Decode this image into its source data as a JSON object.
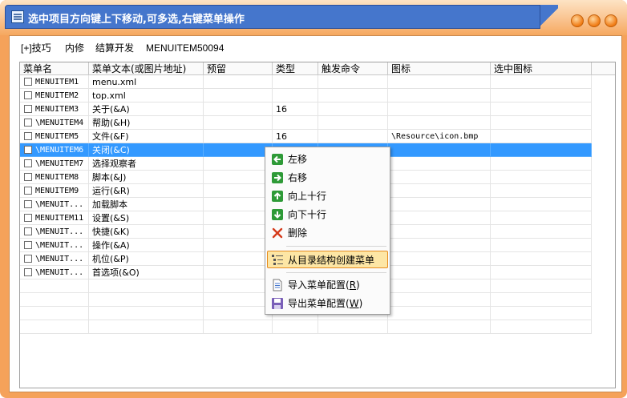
{
  "window": {
    "title": "选中项目方向键上下移动,可多选,右键菜单操作",
    "accent": "#4576cc",
    "frame_color": "#f5a25a"
  },
  "menubar": [
    "[+]技巧",
    "内修",
    "结算开发",
    "MENUITEM50094"
  ],
  "grid": {
    "columns": [
      "菜单名",
      "菜单文本(或图片地址)",
      "预留",
      "类型",
      "触发命令",
      "图标",
      "选中图标"
    ],
    "rows": [
      {
        "name": "MENUITEM1",
        "text": "menu.xml",
        "reserve": "",
        "type": "",
        "cmd": "",
        "icon": "",
        "sel_icon": ""
      },
      {
        "name": "MENUITEM2",
        "text": "top.xml",
        "reserve": "",
        "type": "",
        "cmd": "",
        "icon": "",
        "sel_icon": ""
      },
      {
        "name": "MENUITEM3",
        "text": "关于(&A)",
        "reserve": "",
        "type": "16",
        "cmd": "",
        "icon": "",
        "sel_icon": ""
      },
      {
        "name": "\\MENUITEM4",
        "text": "帮助(&H)",
        "reserve": "",
        "type": "",
        "cmd": "",
        "icon": "",
        "sel_icon": ""
      },
      {
        "name": "MENUITEM5",
        "text": "文件(&F)",
        "reserve": "",
        "type": "16",
        "cmd": "",
        "icon": "\\Resource\\icon.bmp",
        "sel_icon": ""
      },
      {
        "name": "\\MENUITEM6",
        "text": "关闭(&C)",
        "reserve": "",
        "type": "",
        "cmd": "",
        "icon": "",
        "sel_icon": ""
      },
      {
        "name": "\\MENUITEM7",
        "text": "选择观察者",
        "reserve": "",
        "type": "",
        "cmd": "",
        "icon": "",
        "sel_icon": ""
      },
      {
        "name": "MENUITEM8",
        "text": "脚本(&J)",
        "reserve": "",
        "type": "",
        "cmd": "",
        "icon": "",
        "sel_icon": ""
      },
      {
        "name": "MENUITEM9",
        "text": "运行(&R)",
        "reserve": "",
        "type": "",
        "cmd": "",
        "icon": "",
        "sel_icon": ""
      },
      {
        "name": "\\MENUIT...",
        "text": "加载脚本",
        "reserve": "",
        "type": "",
        "cmd": "",
        "icon": "",
        "sel_icon": ""
      },
      {
        "name": "MENUITEM11",
        "text": "设置(&S)",
        "reserve": "",
        "type": "",
        "cmd": "",
        "icon": "",
        "sel_icon": ""
      },
      {
        "name": "\\MENUIT...",
        "text": "快捷(&K)",
        "reserve": "",
        "type": "",
        "cmd": "",
        "icon": "",
        "sel_icon": ""
      },
      {
        "name": "\\MENUIT...",
        "text": "操作(&A)",
        "reserve": "",
        "type": "",
        "cmd": "",
        "icon": "",
        "sel_icon": ""
      },
      {
        "name": "\\MENUIT...",
        "text": "机位(&P)",
        "reserve": "",
        "type": "",
        "cmd": "",
        "icon": "",
        "sel_icon": ""
      },
      {
        "name": "\\MENUIT...",
        "text": "首选项(&O)",
        "reserve": "",
        "type": "",
        "cmd": "",
        "icon": "",
        "sel_icon": ""
      }
    ],
    "selected_row": 5,
    "empty_rows": 4
  },
  "context_menu": {
    "items": [
      {
        "label": "左移",
        "icon": "arrow-left-icon"
      },
      {
        "label": "右移",
        "icon": "arrow-right-icon"
      },
      {
        "label": "向上十行",
        "icon": "arrow-up-icon"
      },
      {
        "label": "向下十行",
        "icon": "arrow-down-icon"
      },
      {
        "label": "删除",
        "icon": "delete-x-icon"
      },
      {
        "label": "从目录结构创建菜单",
        "icon": "tree-list-icon",
        "highlighted": true
      },
      {
        "label": "导入菜单配置",
        "accel": "R",
        "icon": "import-document-icon"
      },
      {
        "label": "导出菜单配置",
        "accel": "W",
        "icon": "save-disk-icon"
      }
    ]
  }
}
